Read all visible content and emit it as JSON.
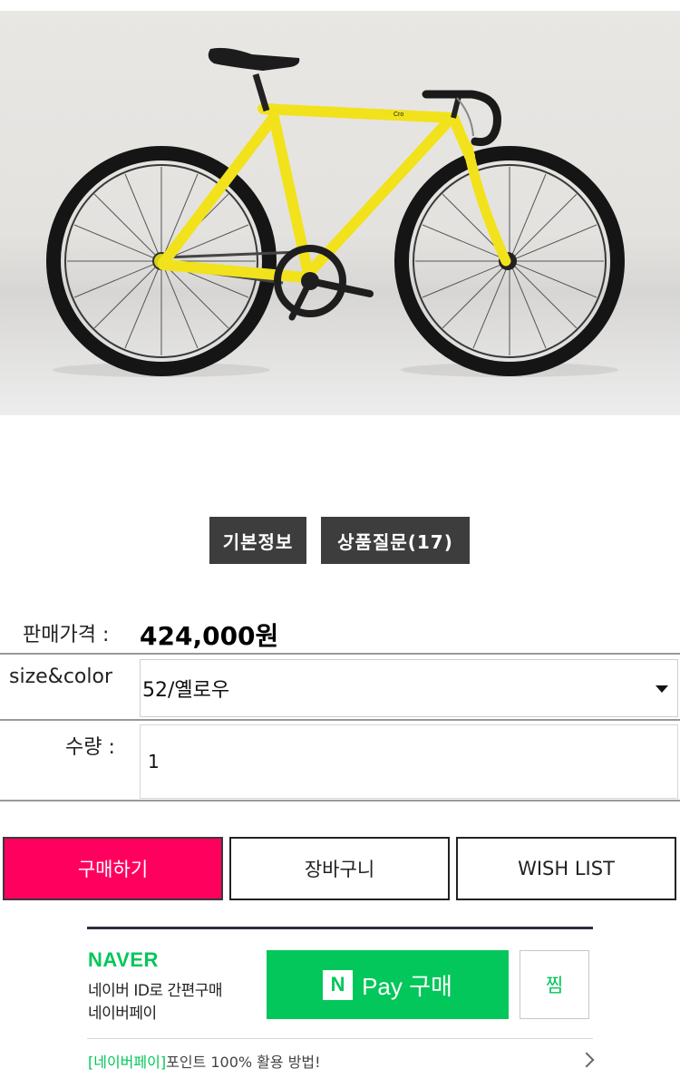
{
  "product": {
    "image_alt": "yellow single-speed bicycle",
    "frame_brand_text": "Cro"
  },
  "tabs": [
    {
      "label": "기본정보"
    },
    {
      "label": "상품질문(17)"
    }
  ],
  "price": {
    "label": "판매가격 :",
    "value": "424,000원"
  },
  "options": {
    "size_color_label": "size&color",
    "size_color_selected": "52/옐로우",
    "quantity_label": "수량 :",
    "quantity_value": "1"
  },
  "actions": {
    "buy_label": "구매하기",
    "cart_label": "장바구니",
    "wish_label": "WISH LIST"
  },
  "naver_pay": {
    "logo": "NAVER",
    "desc_line1": "네이버 ID로 간편구매",
    "desc_line2": "네이버페이",
    "pay_icon": "N",
    "pay_label": "Pay 구매",
    "zzim_label": "찜",
    "promo_green": "[네이버페이]",
    "promo_text": "포인트 100% 활용 방법!"
  },
  "colors": {
    "buy_button": "#ff005f",
    "naver_green": "#03c75a",
    "tab_background": "#3d3d3d",
    "bike_frame": "#f2e21c"
  }
}
